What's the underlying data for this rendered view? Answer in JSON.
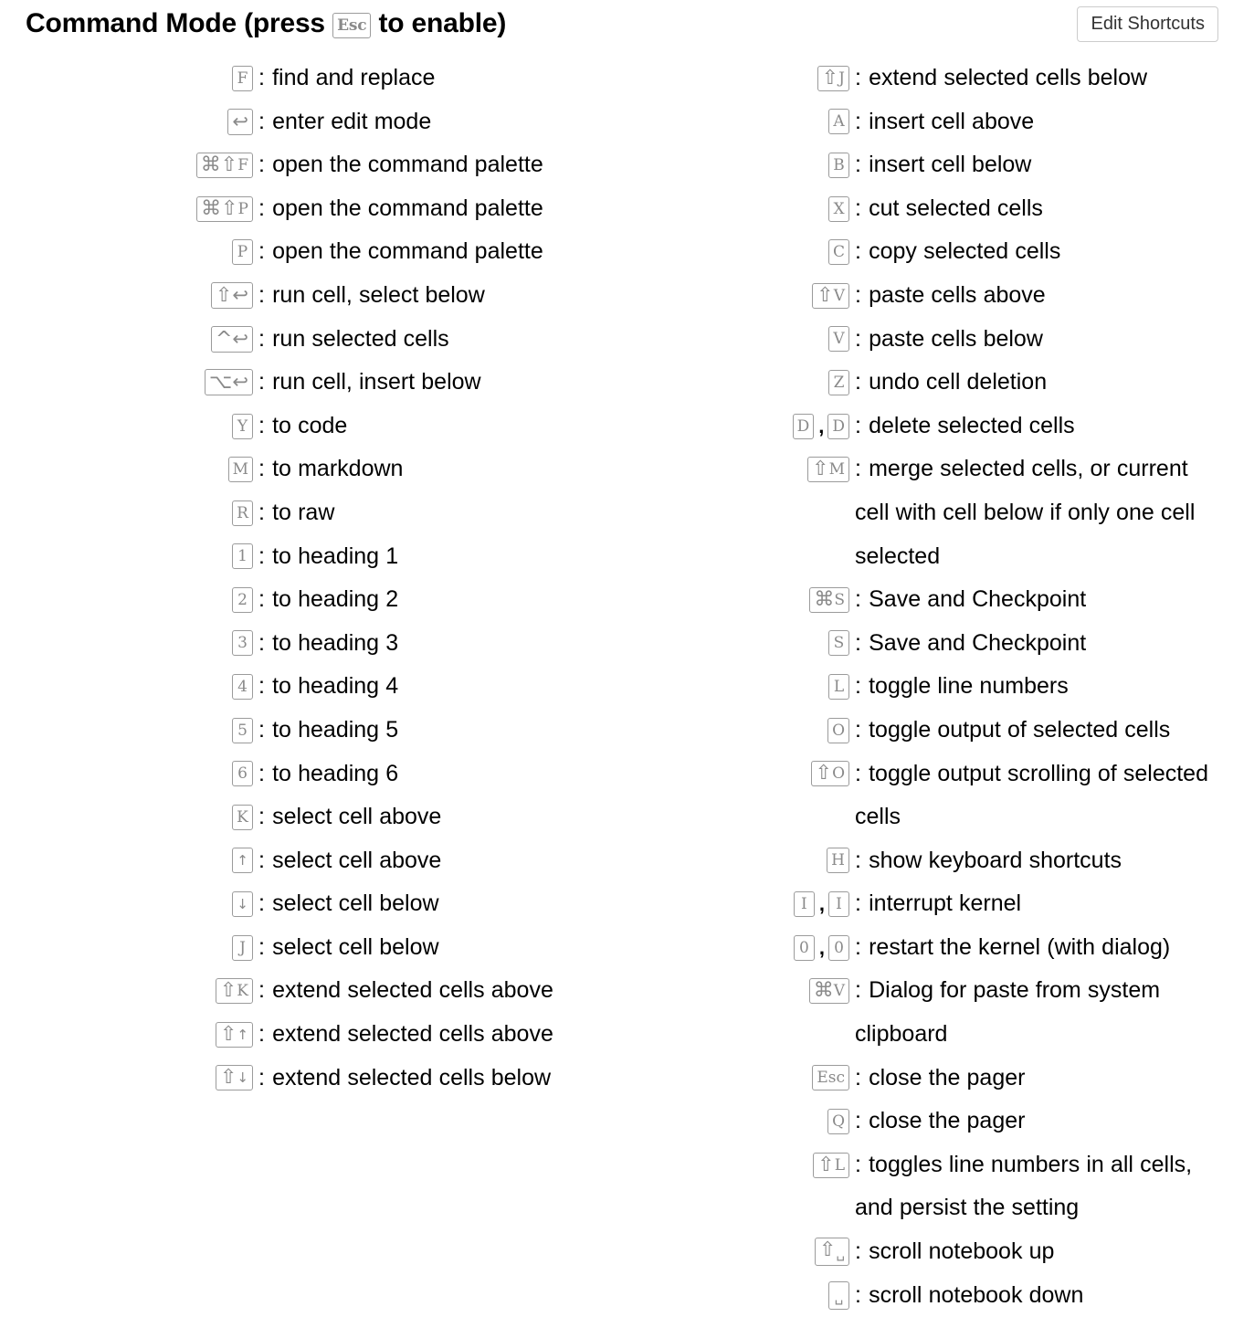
{
  "header": {
    "title_prefix": "Command Mode (press ",
    "title_key": "Esc",
    "title_suffix": " to enable)",
    "edit_button_label": "Edit Shortcuts"
  },
  "columns": {
    "left": [
      {
        "keys": [
          [
            "F"
          ]
        ],
        "desc": "find and replace"
      },
      {
        "keys": [
          [
            "return"
          ]
        ],
        "desc": "enter edit mode"
      },
      {
        "keys": [
          [
            "cmd",
            "shift",
            "F"
          ]
        ],
        "desc": "open the command palette"
      },
      {
        "keys": [
          [
            "cmd",
            "shift",
            "P"
          ]
        ],
        "desc": "open the command palette"
      },
      {
        "keys": [
          [
            "P"
          ]
        ],
        "desc": "open the command palette"
      },
      {
        "keys": [
          [
            "shift",
            "return"
          ]
        ],
        "desc": "run cell, select below"
      },
      {
        "keys": [
          [
            "ctrl",
            "return"
          ]
        ],
        "desc": "run selected cells"
      },
      {
        "keys": [
          [
            "option",
            "return"
          ]
        ],
        "desc": "run cell, insert below"
      },
      {
        "keys": [
          [
            "Y"
          ]
        ],
        "desc": "to code"
      },
      {
        "keys": [
          [
            "M"
          ]
        ],
        "desc": "to markdown"
      },
      {
        "keys": [
          [
            "R"
          ]
        ],
        "desc": "to raw"
      },
      {
        "keys": [
          [
            "1"
          ]
        ],
        "desc": "to heading 1"
      },
      {
        "keys": [
          [
            "2"
          ]
        ],
        "desc": "to heading 2"
      },
      {
        "keys": [
          [
            "3"
          ]
        ],
        "desc": "to heading 3"
      },
      {
        "keys": [
          [
            "4"
          ]
        ],
        "desc": "to heading 4"
      },
      {
        "keys": [
          [
            "5"
          ]
        ],
        "desc": "to heading 5"
      },
      {
        "keys": [
          [
            "6"
          ]
        ],
        "desc": "to heading 6"
      },
      {
        "keys": [
          [
            "K"
          ]
        ],
        "desc": "select cell above"
      },
      {
        "keys": [
          [
            "up"
          ]
        ],
        "desc": "select cell above"
      },
      {
        "keys": [
          [
            "down"
          ]
        ],
        "desc": "select cell below"
      },
      {
        "keys": [
          [
            "J"
          ]
        ],
        "desc": "select cell below"
      },
      {
        "keys": [
          [
            "shift",
            "K"
          ]
        ],
        "desc": "extend selected cells above"
      },
      {
        "keys": [
          [
            "shift",
            "up"
          ]
        ],
        "desc": "extend selected cells above"
      },
      {
        "keys": [
          [
            "shift",
            "down"
          ]
        ],
        "desc": "extend selected cells below"
      }
    ],
    "right": [
      {
        "keys": [
          [
            "shift",
            "J"
          ]
        ],
        "desc": "extend selected cells below"
      },
      {
        "keys": [
          [
            "A"
          ]
        ],
        "desc": "insert cell above"
      },
      {
        "keys": [
          [
            "B"
          ]
        ],
        "desc": "insert cell below"
      },
      {
        "keys": [
          [
            "X"
          ]
        ],
        "desc": "cut selected cells"
      },
      {
        "keys": [
          [
            "C"
          ]
        ],
        "desc": "copy selected cells"
      },
      {
        "keys": [
          [
            "shift",
            "V"
          ]
        ],
        "desc": "paste cells above"
      },
      {
        "keys": [
          [
            "V"
          ]
        ],
        "desc": "paste cells below"
      },
      {
        "keys": [
          [
            "Z"
          ]
        ],
        "desc": "undo cell deletion"
      },
      {
        "keys": [
          [
            "D"
          ],
          [
            "D"
          ]
        ],
        "desc": "delete selected cells"
      },
      {
        "keys": [
          [
            "shift",
            "M"
          ]
        ],
        "desc": "merge selected cells, or current cell with cell below if only one cell selected"
      },
      {
        "keys": [
          [
            "cmd",
            "S"
          ]
        ],
        "desc": "Save and Checkpoint"
      },
      {
        "keys": [
          [
            "S"
          ]
        ],
        "desc": "Save and Checkpoint"
      },
      {
        "keys": [
          [
            "L"
          ]
        ],
        "desc": "toggle line numbers"
      },
      {
        "keys": [
          [
            "O"
          ]
        ],
        "desc": "toggle output of selected cells"
      },
      {
        "keys": [
          [
            "shift",
            "O"
          ]
        ],
        "desc": "toggle output scrolling of selected cells"
      },
      {
        "keys": [
          [
            "H"
          ]
        ],
        "desc": "show keyboard shortcuts"
      },
      {
        "keys": [
          [
            "I"
          ],
          [
            "I"
          ]
        ],
        "desc": "interrupt kernel"
      },
      {
        "keys": [
          [
            "0"
          ],
          [
            "0"
          ]
        ],
        "desc": "restart the kernel (with dialog)"
      },
      {
        "keys": [
          [
            "cmd",
            "V"
          ]
        ],
        "desc": "Dialog for paste from system clipboard"
      },
      {
        "keys": [
          [
            "Esc"
          ]
        ],
        "desc": "close the pager"
      },
      {
        "keys": [
          [
            "Q"
          ]
        ],
        "desc": "close the pager"
      },
      {
        "keys": [
          [
            "shift",
            "L"
          ]
        ],
        "desc": "toggles line numbers in all cells, and persist the setting"
      },
      {
        "keys": [
          [
            "shift",
            "space"
          ]
        ],
        "desc": "scroll notebook up"
      },
      {
        "keys": [
          [
            "space"
          ]
        ],
        "desc": "scroll notebook down"
      }
    ]
  },
  "glyphs": {
    "cmd": "⌘",
    "shift": "⇧",
    "ctrl": "^",
    "option": "⌥",
    "return": "↩",
    "up": "↑",
    "down": "↓",
    "space": "␣"
  },
  "key_separator": ",",
  "colon": ":",
  "colors": {
    "key_border": "#9b9b9b",
    "key_text": "#8a8a8a",
    "button_border": "#cccccc",
    "text": "#000000",
    "background": "#ffffff"
  }
}
